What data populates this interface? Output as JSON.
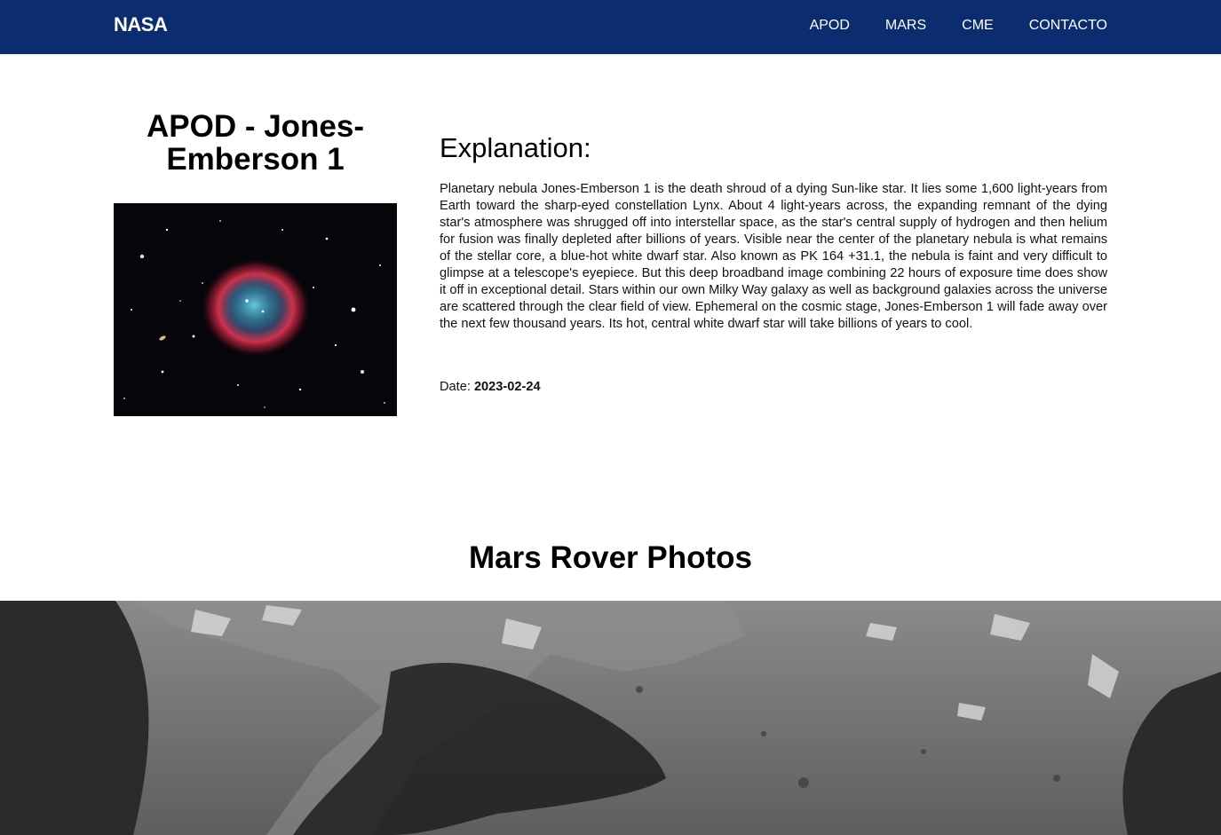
{
  "nav": {
    "brand": "NASA",
    "links": [
      "APOD",
      "MARS",
      "CME",
      "CONTACTO"
    ],
    "background": "#0b2c6f"
  },
  "apod": {
    "title": "APOD - Jones-Emberson 1",
    "image_description_icon": "nebula-image",
    "explanation_heading": "Explanation:",
    "explanation": "Planetary nebula Jones-Emberson 1 is the death shroud of a dying Sun-like star. It lies some 1,600 light-years from Earth toward the sharp-eyed constellation Lynx. About 4 light-years across, the expanding remnant of the dying star's atmosphere was shrugged off into interstellar space, as the star's central supply of hydrogen and then helium for fusion was finally depleted after billions of years. Visible near the center of the planetary nebula is what remains of the stellar core, a blue-hot white dwarf star. Also known as PK 164 +31.1, the nebula is faint and very difficult to glimpse at a telescope's eyepiece. But this deep broadband image combining 22 hours of exposure time does show it off in exceptional detail. Stars within our own Milky Way galaxy as well as background galaxies across the universe are scattered through the clear field of view. Ephemeral on the cosmic stage, Jones-Emberson 1 will fade away over the next few thousand years. Its hot, central white dwarf star will take billions of years to cool.",
    "date_label": "Date: ",
    "date": "2023-02-24"
  },
  "mars": {
    "heading": "Mars Rover Photos"
  }
}
